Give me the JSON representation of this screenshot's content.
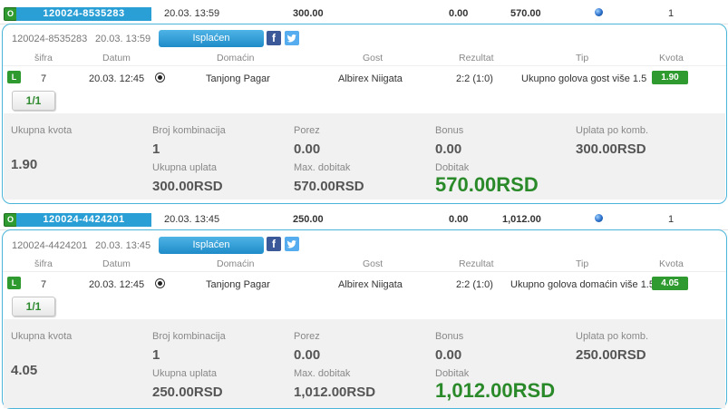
{
  "tickets": [
    {
      "badge": "O",
      "id": "120024-8535283",
      "datetime": "20.03. 13:59",
      "stake": "300.00",
      "tax": "0.00",
      "payout": "570.00",
      "count": "1",
      "detail_id": "120024-8535283",
      "detail_datetime": "20.03. 13:59",
      "status_label": "Isplaćen",
      "row": {
        "code": "7",
        "date": "20.03. 12:45",
        "home": "Tanjong Pagar",
        "away": "Albirex Niigata",
        "result": "2:2 (1:0)",
        "tip": "Ukupno golova gost više 1.5",
        "odds": "1.90"
      },
      "page": "1/1",
      "summary": {
        "total_odds_value": "1.90",
        "combinations_value": "1",
        "total_stake_value": "300.00RSD",
        "tax_value": "0.00",
        "max_win_value": "570.00RSD",
        "bonus_value": "0.00",
        "win_value": "570.00RSD",
        "per_comb_value": "300.00RSD"
      }
    },
    {
      "badge": "O",
      "id": "120024-4424201",
      "datetime": "20.03. 13:45",
      "stake": "250.00",
      "tax": "0.00",
      "payout": "1,012.00",
      "count": "1",
      "detail_id": "120024-4424201",
      "detail_datetime": "20.03. 13:45",
      "status_label": "Isplaćen",
      "row": {
        "code": "7",
        "date": "20.03. 12:45",
        "home": "Tanjong Pagar",
        "away": "Albirex Niigata",
        "result": "2:2 (1:0)",
        "tip": "Ukupno golova domaćin više 1.5",
        "odds": "4.05"
      },
      "page": "1/1",
      "summary": {
        "total_odds_value": "4.05",
        "combinations_value": "1",
        "total_stake_value": "250.00RSD",
        "tax_value": "0.00",
        "max_win_value": "1,012.00RSD",
        "bonus_value": "0.00",
        "win_value": "1,012.00RSD",
        "per_comb_value": "250.00RSD"
      }
    }
  ],
  "labels": {
    "col_code": "šifra",
    "col_date": "Datum",
    "col_home": "Domaćin",
    "col_away": "Gost",
    "col_result": "Rezultat",
    "col_tip": "Tip",
    "col_odds": "Kvota",
    "total_odds": "Ukupna kvota",
    "combinations": "Broj kombinacija",
    "total_stake": "Ukupna uplata",
    "tax": "Porez",
    "max_win": "Max. dobitak",
    "bonus": "Bonus",
    "win": "Dobitak",
    "per_comb": "Uplata po komb.",
    "facebook_glyph": "f",
    "row_badge": "L"
  },
  "colors": {
    "accent_blue": "#2a9fd6",
    "win_green": "#2f9a2f",
    "panel_border": "#4bb5d9"
  }
}
